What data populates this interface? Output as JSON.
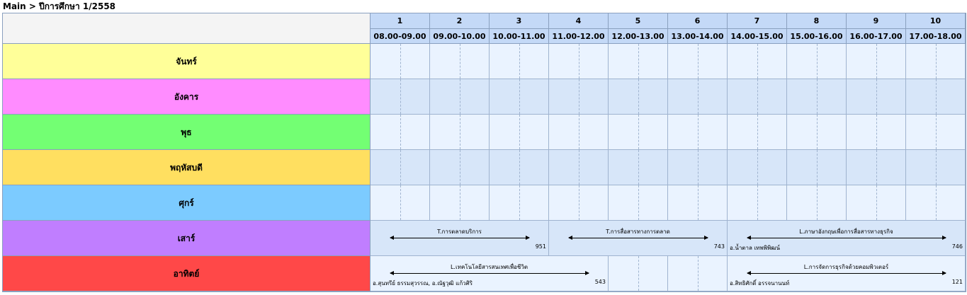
{
  "breadcrumb": "Main > ปีการศึกษา 1/2558",
  "periods": [
    {
      "num": "1",
      "time": "08.00-09.00"
    },
    {
      "num": "2",
      "time": "09.00-10.00"
    },
    {
      "num": "3",
      "time": "10.00-11.00"
    },
    {
      "num": "4",
      "time": "11.00-12.00"
    },
    {
      "num": "5",
      "time": "12.00-13.00"
    },
    {
      "num": "6",
      "time": "13.00-14.00"
    },
    {
      "num": "7",
      "time": "14.00-15.00"
    },
    {
      "num": "8",
      "time": "15.00-16.00"
    },
    {
      "num": "9",
      "time": "16.00-17.00"
    },
    {
      "num": "10",
      "time": "17.00-18.00"
    }
  ],
  "days": [
    {
      "name": "จันทร์",
      "color": "#ffff99",
      "stripe": "odd"
    },
    {
      "name": "อังคาร",
      "color": "#ff8cff",
      "stripe": "even"
    },
    {
      "name": "พุธ",
      "color": "#73ff73",
      "stripe": "odd"
    },
    {
      "name": "พฤหัสบดี",
      "color": "#ffdf60",
      "stripe": "even"
    },
    {
      "name": "ศุกร์",
      "color": "#7ccbff",
      "stripe": "odd"
    },
    {
      "name": "เสาร์",
      "color": "#c07eff",
      "stripe": "even"
    },
    {
      "name": "อาทิตย์",
      "color": "#ff4848",
      "stripe": "odd"
    }
  ],
  "events": [
    {
      "day": 5,
      "start": 0,
      "span": 3,
      "title": "T.การตลาดบริการ",
      "teacher": "",
      "room": "951"
    },
    {
      "day": 5,
      "start": 3,
      "span": 3,
      "title": "T.การสื่อสารทางการตลาด",
      "teacher": "",
      "room": "743"
    },
    {
      "day": 5,
      "start": 6,
      "span": 4,
      "title": "L.ภาษาอังกฤษเพื่อการสื่อสารทางธุรกิจ",
      "teacher": "อ.น้ำตาล เทพพิพิฒน์",
      "room": "746"
    },
    {
      "day": 6,
      "start": 0,
      "span": 4,
      "title": "L.เทคโนโลยีสารสนเทศเพื่อชีวิต",
      "teacher": "อ.สุนทรีย์ ธรรมสุวรรณ, อ.ณัฐวุฒิ แก้วศิริ",
      "room": "543"
    },
    {
      "day": 6,
      "start": 6,
      "span": 4,
      "title": "L.การจัดการธุรกิจด้วยคอมพิวเตอร์",
      "teacher": "อ.สิทธิศักดิ์ อรรจนานนท์",
      "room": "121"
    }
  ]
}
